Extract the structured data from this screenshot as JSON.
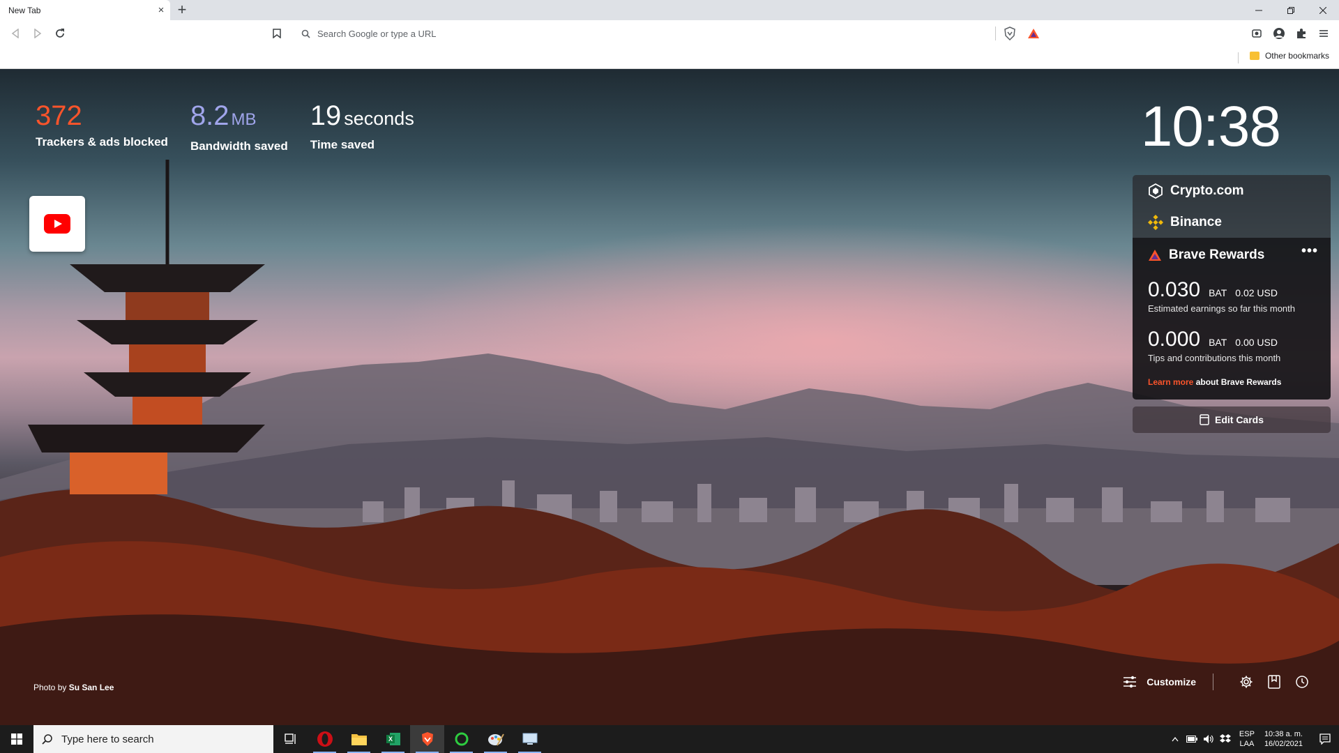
{
  "browser": {
    "tab_title": "New Tab",
    "tab_close": "×",
    "new_tab": "+",
    "omnibox_placeholder": "Search Google or type a URL",
    "other_bookmarks": "Other bookmarks"
  },
  "stats": [
    {
      "value": "372",
      "unit": "",
      "label": "Trackers & ads blocked",
      "color": "#fb542b"
    },
    {
      "value": "8.2",
      "unit": "MB",
      "label": "Bandwidth saved",
      "color": "#a0a5eb"
    },
    {
      "value": "19",
      "unit": "seconds",
      "label": "Time saved",
      "color": "#ffffff"
    }
  ],
  "clock": "10:38",
  "cards": {
    "crypto": "Crypto.com",
    "binance": "Binance",
    "rewards": {
      "title": "Brave Rewards",
      "more": "•••",
      "earnings_amount": "0.030",
      "earnings_currency": "BAT",
      "earnings_usd": "0.02 USD",
      "earnings_label": "Estimated earnings so far this month",
      "tips_amount": "0.000",
      "tips_currency": "BAT",
      "tips_usd": "0.00 USD",
      "tips_label": "Tips and contributions this month",
      "learn_more": "Learn more",
      "learn_more_suffix": " about Brave Rewards"
    },
    "edit_cards": "Edit Cards"
  },
  "credit": {
    "prefix": "Photo by ",
    "author": "Su San Lee"
  },
  "controls": {
    "customize": "Customize"
  },
  "taskbar": {
    "search_placeholder": "Type here to search",
    "lang_top": "ESP",
    "lang_bottom": "LAA",
    "time": "10:38 a. m.",
    "date": "16/02/2021"
  },
  "colors": {
    "brave_orange": "#fb542b",
    "binance_yellow": "#f0b90b"
  }
}
